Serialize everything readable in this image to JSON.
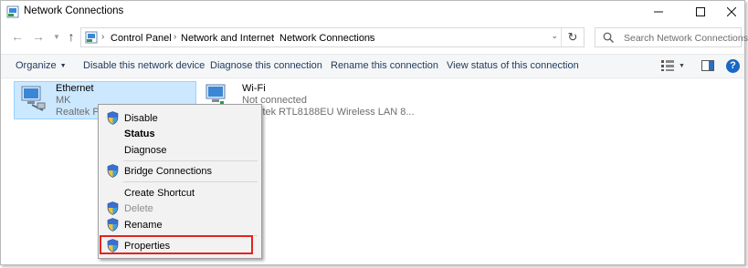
{
  "window": {
    "title": "Network Connections"
  },
  "address_bar": {
    "breadcrumbs": [
      "Control Panel",
      "Network and Internet",
      "Network Connections"
    ],
    "search_placeholder": "Search Network Connections"
  },
  "command_bar": {
    "organize": "Organize",
    "disable": "Disable this network device",
    "diagnose": "Diagnose this connection",
    "rename": "Rename this connection",
    "view_status": "View status of this connection"
  },
  "connections": [
    {
      "name": "Ethernet",
      "network": "MK",
      "adapter": "Realtek PCI"
    },
    {
      "name": "Wi-Fi",
      "status": "Not connected",
      "adapter": "ltek RTL8188EU Wireless LAN 8..."
    }
  ],
  "context_menu": {
    "items": [
      "Disable",
      "Status",
      "Diagnose",
      "Bridge Connections",
      "Create Shortcut",
      "Delete",
      "Rename",
      "Properties"
    ]
  },
  "colors": {
    "selection": "#cce8ff",
    "highlight_box": "#e0241f",
    "accent": "#1a67c4"
  }
}
